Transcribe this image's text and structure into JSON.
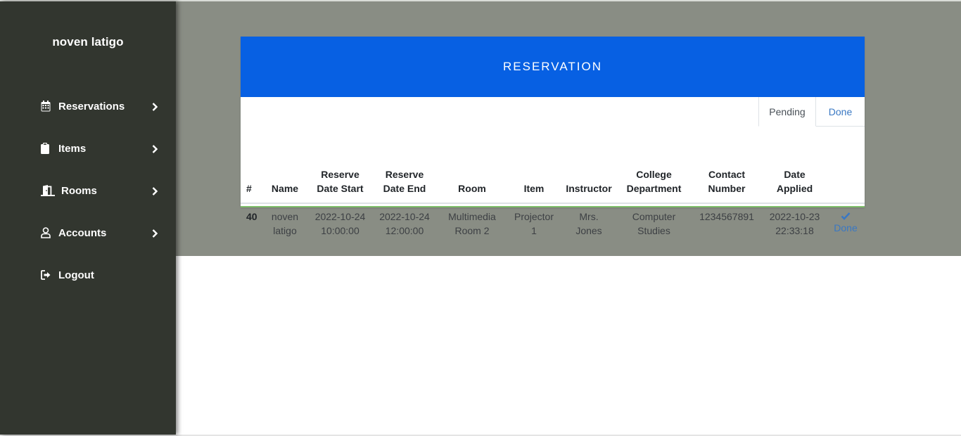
{
  "sidebar": {
    "brand": "noven latigo",
    "items": [
      {
        "label": "Reservations",
        "icon": "calendar-icon"
      },
      {
        "label": "Items",
        "icon": "clipboard-icon"
      },
      {
        "label": "Rooms",
        "icon": "door-icon"
      },
      {
        "label": "Accounts",
        "icon": "user-icon"
      },
      {
        "label": "Logout",
        "icon": "logout-icon"
      }
    ]
  },
  "card": {
    "title": "RESERVATION",
    "tabs": [
      {
        "label": "Pending",
        "active": true
      },
      {
        "label": "Done",
        "active": false
      }
    ]
  },
  "table": {
    "headers": {
      "num": "#",
      "name": "Name",
      "start_1": "Reserve",
      "start_2": "Date Start",
      "end_1": "Reserve",
      "end_2": "Date End",
      "room": "Room",
      "item": "Item",
      "instructor": "Instructor",
      "dept_1": "College",
      "dept_2": "Department",
      "contact_1": "Contact",
      "contact_2": "Number",
      "applied_1": "Date",
      "applied_2": "Applied"
    },
    "rows": [
      {
        "num": "40",
        "name_1": "noven",
        "name_2": "latigo",
        "start_date": "2022-10-24",
        "start_time": "10:00:00",
        "end_date": "2022-10-24",
        "end_time": "12:00:00",
        "room_1": "Multimedia",
        "room_2": "Room 2",
        "item_1": "Projector",
        "item_2": "1",
        "instructor_1": "Mrs.",
        "instructor_2": "Jones",
        "dept_1": "Computer",
        "dept_2": "Studies",
        "contact": "1234567891",
        "applied_date": "2022-10-23",
        "applied_time": "22:33:18",
        "action": "Done"
      }
    ]
  },
  "colors": {
    "sidebar_bg": "#32362f",
    "content_bg": "#898d84",
    "header_bg": "#0760e3",
    "link": "#3a78c3"
  }
}
